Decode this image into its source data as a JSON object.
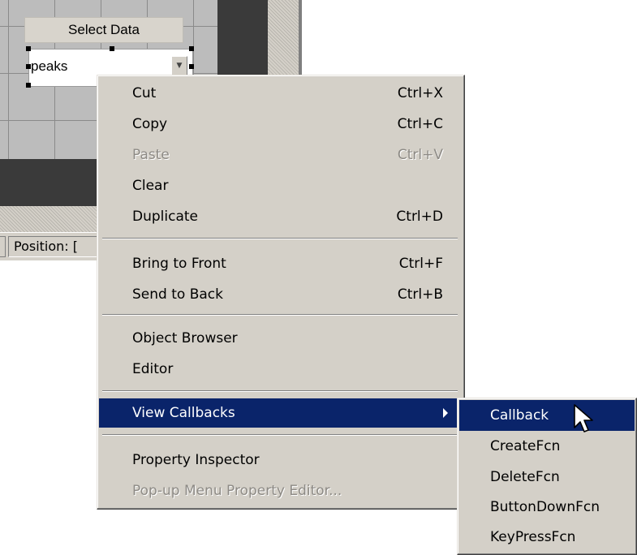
{
  "background": {
    "select_data_label": "Select Data",
    "popup_value": "peaks",
    "status_label": "Position: ["
  },
  "context_menu": {
    "items": [
      {
        "label": "Cut",
        "shortcut": "Ctrl+X",
        "enabled": true
      },
      {
        "label": "Copy",
        "shortcut": "Ctrl+C",
        "enabled": true
      },
      {
        "label": "Paste",
        "shortcut": "Ctrl+V",
        "enabled": false
      },
      {
        "label": "Clear",
        "shortcut": "",
        "enabled": true
      },
      {
        "label": "Duplicate",
        "shortcut": "Ctrl+D",
        "enabled": true
      },
      {
        "label": "Bring to Front",
        "shortcut": "Ctrl+F",
        "enabled": true
      },
      {
        "label": "Send to Back",
        "shortcut": "Ctrl+B",
        "enabled": true
      },
      {
        "label": "Object Browser",
        "shortcut": "",
        "enabled": true
      },
      {
        "label": "Editor",
        "shortcut": "",
        "enabled": true
      },
      {
        "label": "View Callbacks",
        "shortcut": "",
        "enabled": true,
        "highlighted": true,
        "has_submenu": true
      },
      {
        "label": "Property Inspector",
        "shortcut": "",
        "enabled": true
      },
      {
        "label": "Pop-up Menu Property Editor...",
        "shortcut": "",
        "enabled": false
      }
    ]
  },
  "submenu": {
    "items": [
      {
        "label": "Callback",
        "highlighted": true
      },
      {
        "label": "CreateFcn"
      },
      {
        "label": "DeleteFcn"
      },
      {
        "label": "ButtonDownFcn"
      },
      {
        "label": "KeyPressFcn"
      }
    ]
  },
  "colors": {
    "menu_face": "#d4d0c8",
    "highlight": "#0a246a",
    "disabled_text": "#8d8a85"
  }
}
